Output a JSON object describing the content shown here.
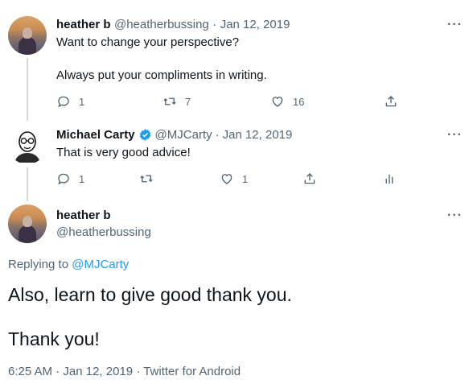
{
  "tweet1": {
    "name": "heather b",
    "handle": "@heatherbussing",
    "sep": "·",
    "date": "Jan 12, 2019",
    "line1": "Want to change your perspective?",
    "line2": "Always put your compliments in writing.",
    "replies": "1",
    "retweets": "7",
    "likes": "16"
  },
  "tweet2": {
    "name": "Michael Carty",
    "handle": "@MJCarty",
    "sep": "·",
    "date": "Jan 12, 2019",
    "text": "That is very good advice!",
    "replies": "1",
    "likes": "1"
  },
  "main": {
    "name": "heather b",
    "handle": "@heatherbussing",
    "replying_prefix": "Replying to",
    "replying_to": "@MJCarty",
    "text1": "Also, learn to give good thank you.",
    "text2": "Thank you!",
    "time": "6:25 AM",
    "sep": "·",
    "date": "Jan 12, 2019",
    "sep2": "·",
    "source": "Twitter for Android"
  },
  "more_label": "···",
  "colors": {
    "accent": "#1d9bf0",
    "muted": "#536471",
    "text": "#0f1419",
    "line": "#cfd9de"
  },
  "icons": {
    "reply": "reply-icon",
    "retweet": "retweet-icon",
    "like": "heart-icon",
    "share": "share-icon",
    "analytics": "analytics-icon",
    "verified": "verified-badge-icon",
    "more": "more-icon"
  }
}
